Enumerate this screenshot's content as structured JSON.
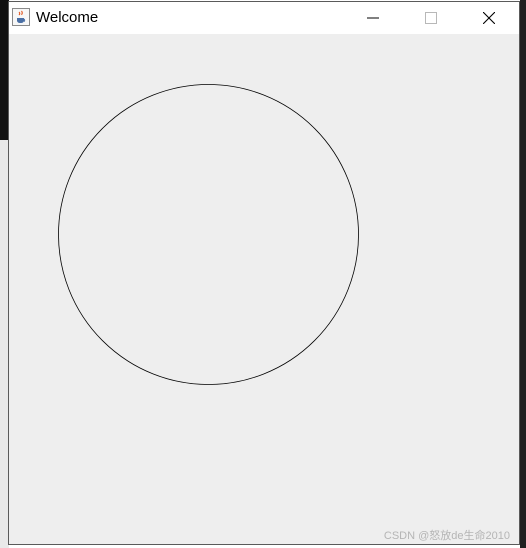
{
  "window": {
    "title": "Welcome",
    "controls": {
      "minimize": "minimize-icon",
      "maximize": "maximize-icon",
      "close": "close-icon"
    },
    "app_icon": "java-cup-icon",
    "client_background": "#eeeeee"
  },
  "canvas": {
    "shape": "circle",
    "stroke_color": "#000000",
    "fill": "none"
  },
  "watermark": {
    "text": "CSDN @怒放de生命2010"
  }
}
